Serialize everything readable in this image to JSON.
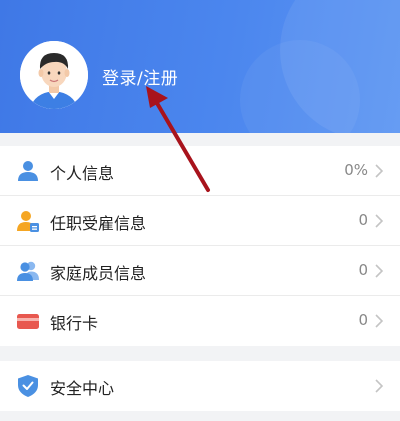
{
  "header": {
    "login_label": "登录/注册"
  },
  "menu_group_1": {
    "items": [
      {
        "label": "个人信息",
        "value": "0%",
        "icon": "person-icon"
      },
      {
        "label": "任职受雇信息",
        "value": "0",
        "icon": "employee-badge-icon"
      },
      {
        "label": "家庭成员信息",
        "value": "0",
        "icon": "family-icon"
      },
      {
        "label": "银行卡",
        "value": "0",
        "icon": "bank-card-icon"
      }
    ]
  },
  "menu_group_2": {
    "items": [
      {
        "label": "安全中心",
        "icon": "shield-icon"
      }
    ]
  },
  "colors": {
    "header_blue": "#4580ea",
    "icon_blue": "#4a90e2",
    "icon_orange": "#f5a623",
    "card_red": "#e8584f",
    "annotation_arrow": "#a8131c"
  }
}
